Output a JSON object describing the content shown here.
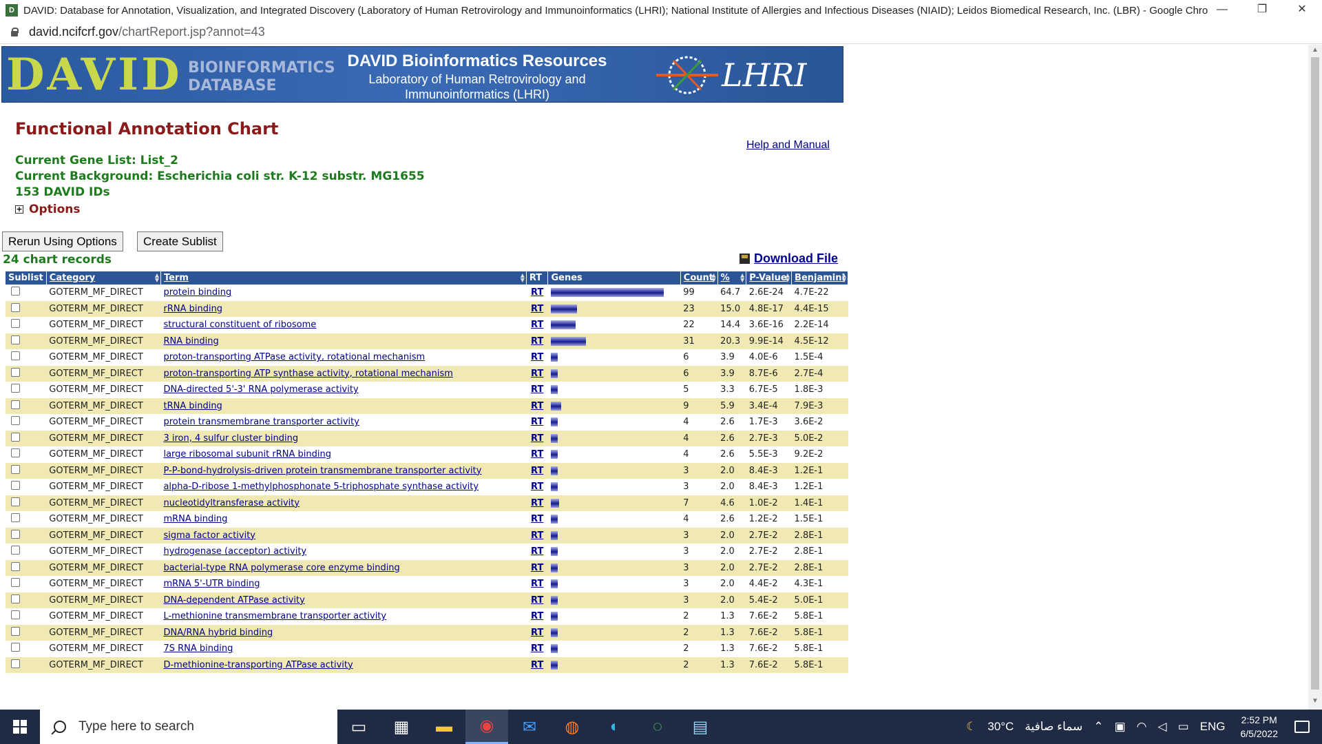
{
  "window": {
    "title": "DAVID: Database for Annotation, Visualization, and Integrated Discovery (Laboratory of Human Retrovirology and Immunoinformatics (LHRI); National Institute of Allergies and Infectious Diseases (NIAID); Leidos Biomedical Research, Inc. (LBR) - Google Chrome",
    "minimize": "—",
    "restore": "❐",
    "close": "✕"
  },
  "address": {
    "host": "david.ncifcrf.gov",
    "path": "/chartReport.jsp?annot=43"
  },
  "banner": {
    "logo": "DAVID",
    "logo_sub_1": "BIOINFORMATICS",
    "logo_sub_2": "DATABASE",
    "heading": "DAVID Bioinformatics Resources",
    "sub_1": "Laboratory of Human Retrovirology and",
    "sub_2": "Immunoinformatics (LHRI)",
    "lhri": "LHRI"
  },
  "page": {
    "title": "Functional Annotation Chart",
    "help": "Help and Manual",
    "gene_list": "Current Gene List: List_2",
    "background": "Current Background: Escherichia coli str. K-12 substr. MG1655",
    "ids": "153 DAVID IDs",
    "options": "Options",
    "rerun": "Rerun Using Options",
    "sublist": "Create Sublist",
    "records": "24 chart records",
    "download": "Download File"
  },
  "table": {
    "headers": {
      "sublist": "Sublist",
      "category": "Category",
      "term": "Term",
      "rt": "RT",
      "genes": "Genes",
      "count": "Count",
      "pct": "%",
      "pvalue": "P-Value",
      "benjamini": "Benjamini"
    },
    "rows": [
      {
        "category": "GOTERM_MF_DIRECT",
        "term": "protein binding",
        "rt": "RT",
        "count": "99",
        "pct": "64.7",
        "pvalue": "2.6E-24",
        "benjamini": "4.7E-22"
      },
      {
        "category": "GOTERM_MF_DIRECT",
        "term": "rRNA binding",
        "rt": "RT",
        "count": "23",
        "pct": "15.0",
        "pvalue": "4.8E-17",
        "benjamini": "4.4E-15"
      },
      {
        "category": "GOTERM_MF_DIRECT",
        "term": "structural constituent of ribosome",
        "rt": "RT",
        "count": "22",
        "pct": "14.4",
        "pvalue": "3.6E-16",
        "benjamini": "2.2E-14"
      },
      {
        "category": "GOTERM_MF_DIRECT",
        "term": "RNA binding",
        "rt": "RT",
        "count": "31",
        "pct": "20.3",
        "pvalue": "9.9E-14",
        "benjamini": "4.5E-12"
      },
      {
        "category": "GOTERM_MF_DIRECT",
        "term": "proton-transporting ATPase activity, rotational mechanism",
        "rt": "RT",
        "count": "6",
        "pct": "3.9",
        "pvalue": "4.0E-6",
        "benjamini": "1.5E-4"
      },
      {
        "category": "GOTERM_MF_DIRECT",
        "term": "proton-transporting ATP synthase activity, rotational mechanism",
        "rt": "RT",
        "count": "6",
        "pct": "3.9",
        "pvalue": "8.7E-6",
        "benjamini": "2.7E-4"
      },
      {
        "category": "GOTERM_MF_DIRECT",
        "term": "DNA-directed 5'-3' RNA polymerase activity",
        "rt": "RT",
        "count": "5",
        "pct": "3.3",
        "pvalue": "6.7E-5",
        "benjamini": "1.8E-3"
      },
      {
        "category": "GOTERM_MF_DIRECT",
        "term": "tRNA binding",
        "rt": "RT",
        "count": "9",
        "pct": "5.9",
        "pvalue": "3.4E-4",
        "benjamini": "7.9E-3"
      },
      {
        "category": "GOTERM_MF_DIRECT",
        "term": "protein transmembrane transporter activity",
        "rt": "RT",
        "count": "4",
        "pct": "2.6",
        "pvalue": "1.7E-3",
        "benjamini": "3.6E-2"
      },
      {
        "category": "GOTERM_MF_DIRECT",
        "term": "3 iron, 4 sulfur cluster binding",
        "rt": "RT",
        "count": "4",
        "pct": "2.6",
        "pvalue": "2.7E-3",
        "benjamini": "5.0E-2"
      },
      {
        "category": "GOTERM_MF_DIRECT",
        "term": "large ribosomal subunit rRNA binding",
        "rt": "RT",
        "count": "4",
        "pct": "2.6",
        "pvalue": "5.5E-3",
        "benjamini": "9.2E-2"
      },
      {
        "category": "GOTERM_MF_DIRECT",
        "term": "P-P-bond-hydrolysis-driven protein transmembrane transporter activity",
        "rt": "RT",
        "count": "3",
        "pct": "2.0",
        "pvalue": "8.4E-3",
        "benjamini": "1.2E-1"
      },
      {
        "category": "GOTERM_MF_DIRECT",
        "term": "alpha-D-ribose 1-methylphosphonate 5-triphosphate synthase activity",
        "rt": "RT",
        "count": "3",
        "pct": "2.0",
        "pvalue": "8.4E-3",
        "benjamini": "1.2E-1"
      },
      {
        "category": "GOTERM_MF_DIRECT",
        "term": "nucleotidyltransferase activity",
        "rt": "RT",
        "count": "7",
        "pct": "4.6",
        "pvalue": "1.0E-2",
        "benjamini": "1.4E-1"
      },
      {
        "category": "GOTERM_MF_DIRECT",
        "term": "mRNA binding",
        "rt": "RT",
        "count": "4",
        "pct": "2.6",
        "pvalue": "1.2E-2",
        "benjamini": "1.5E-1"
      },
      {
        "category": "GOTERM_MF_DIRECT",
        "term": "sigma factor activity",
        "rt": "RT",
        "count": "3",
        "pct": "2.0",
        "pvalue": "2.7E-2",
        "benjamini": "2.8E-1"
      },
      {
        "category": "GOTERM_MF_DIRECT",
        "term": "hydrogenase (acceptor) activity",
        "rt": "RT",
        "count": "3",
        "pct": "2.0",
        "pvalue": "2.7E-2",
        "benjamini": "2.8E-1"
      },
      {
        "category": "GOTERM_MF_DIRECT",
        "term": "bacterial-type RNA polymerase core enzyme binding",
        "rt": "RT",
        "count": "3",
        "pct": "2.0",
        "pvalue": "2.7E-2",
        "benjamini": "2.8E-1"
      },
      {
        "category": "GOTERM_MF_DIRECT",
        "term": "mRNA 5'-UTR binding",
        "rt": "RT",
        "count": "3",
        "pct": "2.0",
        "pvalue": "4.4E-2",
        "benjamini": "4.3E-1"
      },
      {
        "category": "GOTERM_MF_DIRECT",
        "term": "DNA-dependent ATPase activity",
        "rt": "RT",
        "count": "3",
        "pct": "2.0",
        "pvalue": "5.4E-2",
        "benjamini": "5.0E-1"
      },
      {
        "category": "GOTERM_MF_DIRECT",
        "term": "L-methionine transmembrane transporter activity",
        "rt": "RT",
        "count": "2",
        "pct": "1.3",
        "pvalue": "7.6E-2",
        "benjamini": "5.8E-1"
      },
      {
        "category": "GOTERM_MF_DIRECT",
        "term": "DNA/RNA hybrid binding",
        "rt": "RT",
        "count": "2",
        "pct": "1.3",
        "pvalue": "7.6E-2",
        "benjamini": "5.8E-1"
      },
      {
        "category": "GOTERM_MF_DIRECT",
        "term": "7S RNA binding",
        "rt": "RT",
        "count": "2",
        "pct": "1.3",
        "pvalue": "7.6E-2",
        "benjamini": "5.8E-1"
      },
      {
        "category": "GOTERM_MF_DIRECT",
        "term": "D-methionine-transporting ATPase activity",
        "rt": "RT",
        "count": "2",
        "pct": "1.3",
        "pvalue": "7.6E-2",
        "benjamini": "5.8E-1"
      }
    ]
  },
  "taskbar": {
    "search_placeholder": "Type here to search",
    "weather": "30°C",
    "weather_text": "سماء صافية",
    "lang": "ENG",
    "time": "2:52 PM",
    "date": "6/5/2022"
  }
}
